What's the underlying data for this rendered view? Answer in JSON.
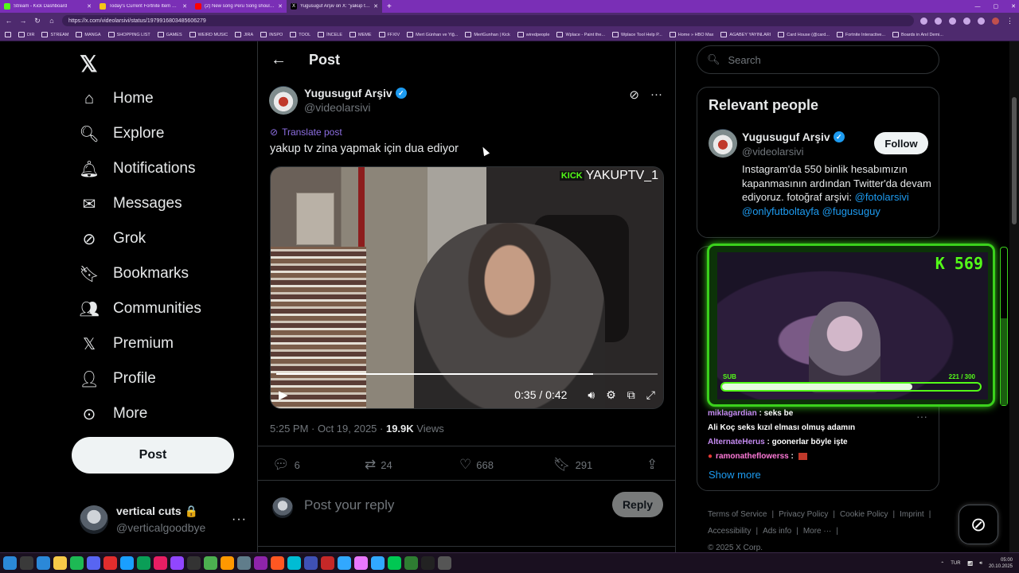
{
  "browser": {
    "tabs": [
      {
        "title": "Stream - Kick Dashboard",
        "color": "#53fc18"
      },
      {
        "title": "Today's Current Fortnite Item Sh...",
        "color": "#f5c518"
      },
      {
        "title": "(2) New song Peru Song should l...",
        "color": "#ff0000"
      },
      {
        "title": "Yugusuguf Arşiv on X: \"yakup tv ...",
        "color": "#000000"
      }
    ],
    "url": "https://x.com/videolarsivi/status/1979916803485606279",
    "bookmarks": [
      "DIR",
      "STREAM",
      "MANGA",
      "SHOPPING LIST",
      "GAMES",
      "WEIRD MUSIC",
      "JIRA",
      "INSPO",
      "TOOL",
      "İNCELE",
      "MEME",
      "FFXIV",
      "Mert Günhan ve Yiğ...",
      "MertGunhan | Kick",
      "wiredpeople",
      "Wplace - Paint the...",
      "Wplace Tool Help P...",
      "Home » HBO Max",
      "AGABEY YAYINLARI",
      "Card House (@card...",
      "Fortnite Interactive...",
      "Boards in Anıl Demi..."
    ]
  },
  "nav": {
    "items": [
      {
        "label": "Home",
        "icon": "home-icon"
      },
      {
        "label": "Explore",
        "icon": "search-icon"
      },
      {
        "label": "Notifications",
        "icon": "bell-icon"
      },
      {
        "label": "Messages",
        "icon": "envelope-icon"
      },
      {
        "label": "Grok",
        "icon": "grok-icon"
      },
      {
        "label": "Bookmarks",
        "icon": "bookmark-icon"
      },
      {
        "label": "Communities",
        "icon": "people-icon"
      },
      {
        "label": "Premium",
        "icon": "x-logo-icon"
      },
      {
        "label": "Profile",
        "icon": "person-icon"
      },
      {
        "label": "More",
        "icon": "more-circle-icon"
      }
    ],
    "post_label": "Post",
    "account": {
      "name": "vertical cuts",
      "handle": "@verticalgoodbye"
    }
  },
  "post": {
    "header_title": "Post",
    "author_name": "Yugusuguf Arşiv",
    "author_handle": "@videolarsivi",
    "translate_label": "Translate post",
    "text": "yakup tv zina yapmak için dua ediyor",
    "video": {
      "watermark": "YAKUPTV_1",
      "watermark_brand": "KICK",
      "time": "0:35 / 0:42",
      "progress": 0.83
    },
    "timestamp": "5:25 PM · Oct 19, 2025 · ",
    "views_count": "19.9K",
    "views_label": " Views",
    "stats": {
      "replies": "6",
      "reposts": "24",
      "likes": "668",
      "bookmarks": "291"
    },
    "reply_placeholder": "Post your reply",
    "reply_button": "Reply"
  },
  "sidebar": {
    "search_placeholder": "Search",
    "relevant_title": "Relevant people",
    "person_name": "Yugusuguf Arşiv",
    "person_handle": "@videolarsivi",
    "follow_label": "Follow",
    "bio_text": "Instagram'da 550 binlik hesabımızın kapanmasının ardından Twitter'da devam ediyoruz. fotoğraf arşivi: ",
    "bio_mentions": [
      "@fotolarsivi",
      "@onlyfutboltayfa",
      "@fugusuguy"
    ],
    "show_more": "Show more",
    "footer_links": [
      "Terms of Service",
      "Privacy Policy",
      "Cookie Policy",
      "Imprint",
      "Accessibility",
      "Ads info",
      "More ···"
    ],
    "copyright": "© 2025 X Corp."
  },
  "overlay": {
    "count": "K 569",
    "sub_label": "SUB",
    "sub_progress": "221  / 300",
    "sub_fraction": 0.737,
    "chat": [
      {
        "user": "miklagardian",
        "msg": " : seks be"
      },
      {
        "user": "Ali Koç",
        "msg": " seks kızıl elması olmuş adamın"
      },
      {
        "user": "AlternateHerus",
        "msg": " : goonerlar böyle işte"
      },
      {
        "user": "ramonatheflowerss",
        "msg": " : "
      }
    ]
  },
  "taskbar": {
    "lang": "TUR",
    "time": "05:00",
    "date": "20.10.2025"
  },
  "colors": {
    "accent": "#1d9bf0",
    "kick_green": "#53fc18",
    "browser_purple": "#7a2fb6"
  }
}
